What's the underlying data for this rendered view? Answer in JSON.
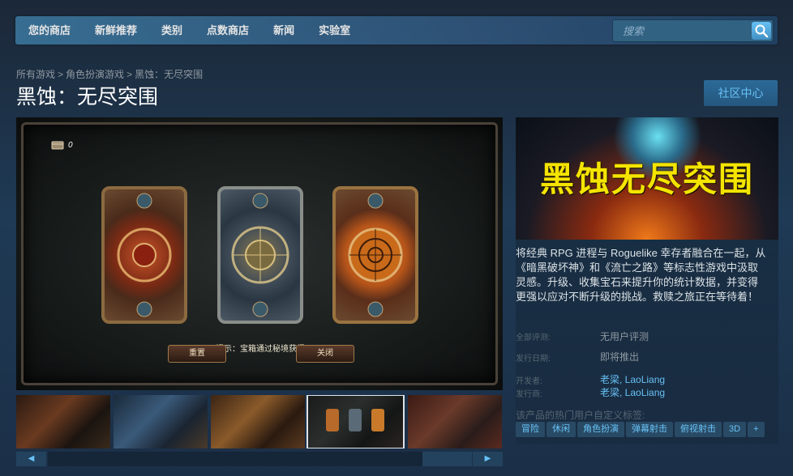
{
  "nav": {
    "items": [
      {
        "label": "您的商店"
      },
      {
        "label": "新鲜推荐"
      },
      {
        "label": "类别"
      },
      {
        "label": "点数商店"
      },
      {
        "label": "新闻"
      },
      {
        "label": "实验室"
      }
    ],
    "search_placeholder": "搜索"
  },
  "breadcrumb": [
    "所有游戏",
    "角色扮演游戏",
    "黑蚀：无尽突围"
  ],
  "page_title": "黑蚀：无尽突围",
  "community_button": "社区中心",
  "main_media": {
    "coin_count": "0",
    "hint": "提示：宝箱通过秘境获得",
    "reset_label": "重置",
    "close_label": "关闭"
  },
  "capsule_title": "黑蚀无尽突围",
  "description": "将经典 RPG 进程与 Roguelike 幸存者融合在一起，从《暗黑破坏神》和《流亡之路》等标志性游戏中汲取灵感。升级、收集宝石来提升你的统计数据，并变得更强以应对不断升级的挑战。救赎之旅正在等待着！",
  "info": {
    "reviews_label": "全部评测:",
    "reviews_value": "无用户评测",
    "release_label": "发行日期:",
    "release_value": "即将推出",
    "developer_label": "开发者:",
    "developer_value": "老梁, LaoLiang",
    "publisher_label": "发行商:",
    "publisher_value": "老梁, LaoLiang"
  },
  "tags_label": "该产品的热门用户自定义标签:",
  "tags": [
    "冒险",
    "休闲",
    "角色扮演",
    "弹幕射击",
    "俯视射击",
    "3D",
    "+"
  ],
  "scroll": {
    "left": "◀",
    "right": "▶"
  }
}
